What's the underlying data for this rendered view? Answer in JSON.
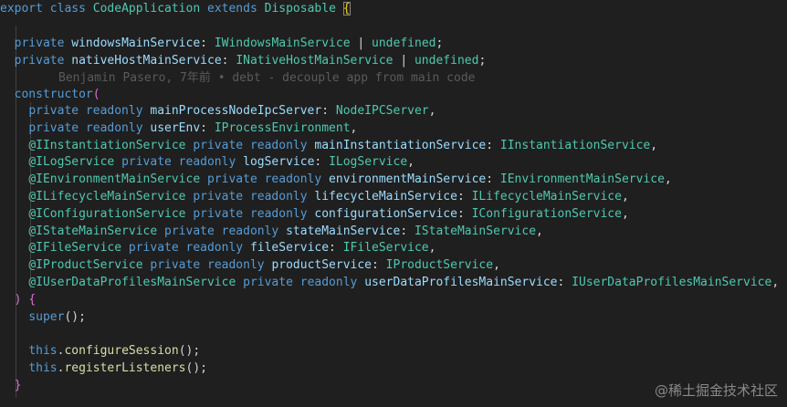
{
  "code": {
    "l0": {
      "export": "export",
      "class": "class",
      "name": "CodeApplication",
      "extends": "extends",
      "base": "Disposable",
      "brace": "{"
    },
    "l2": {
      "mod": "private",
      "prop": "windowsMainService",
      "colon": ": ",
      "type": "IWindowsMainService",
      "union": " | ",
      "undef": "undefined",
      "semi": ";"
    },
    "l3": {
      "mod": "private",
      "prop": "nativeHostMainService",
      "colon": ": ",
      "type": "INativeHostMainService",
      "union": " | ",
      "undef": "undefined",
      "semi": ";"
    },
    "blame": "Benjamin Pasero, 7年前 • debt - decouple app from main code",
    "ctor": {
      "name": "constructor",
      "paren": "("
    },
    "params": [
      {
        "dec": "",
        "mods": "private readonly",
        "name": "mainProcessNodeIpcServer",
        "type": "NodeIPCServer"
      },
      {
        "dec": "",
        "mods": "private readonly",
        "name": "userEnv",
        "type": "IProcessEnvironment"
      },
      {
        "dec": "@IInstantiationService",
        "mods": "private readonly",
        "name": "mainInstantiationService",
        "type": "IInstantiationService"
      },
      {
        "dec": "@ILogService",
        "mods": "private readonly",
        "name": "logService",
        "type": "ILogService"
      },
      {
        "dec": "@IEnvironmentMainService",
        "mods": "private readonly",
        "name": "environmentMainService",
        "type": "IEnvironmentMainService"
      },
      {
        "dec": "@ILifecycleMainService",
        "mods": "private readonly",
        "name": "lifecycleMainService",
        "type": "ILifecycleMainService"
      },
      {
        "dec": "@IConfigurationService",
        "mods": "private readonly",
        "name": "configurationService",
        "type": "IConfigurationService"
      },
      {
        "dec": "@IStateMainService",
        "mods": "private readonly",
        "name": "stateMainService",
        "type": "IStateMainService"
      },
      {
        "dec": "@IFileService",
        "mods": "private readonly",
        "name": "fileService",
        "type": "IFileService"
      },
      {
        "dec": "@IProductService",
        "mods": "private readonly",
        "name": "productService",
        "type": "IProductService"
      },
      {
        "dec": "@IUserDataProfilesMainService",
        "mods": "private readonly",
        "name": "userDataProfilesMainService",
        "type": "IUserDataProfilesMainService"
      }
    ],
    "closeParams": {
      "paren": ")",
      "brace": "{"
    },
    "super": {
      "fn": "super",
      "args": "();"
    },
    "call1": {
      "obj": "this",
      "dot": ".",
      "fn": "configureSession",
      "args": "();"
    },
    "call2": {
      "obj": "this",
      "dot": ".",
      "fn": "registerListeners",
      "args": "();"
    },
    "endBrace": "}"
  },
  "watermark": "@稀土掘金技术社区"
}
